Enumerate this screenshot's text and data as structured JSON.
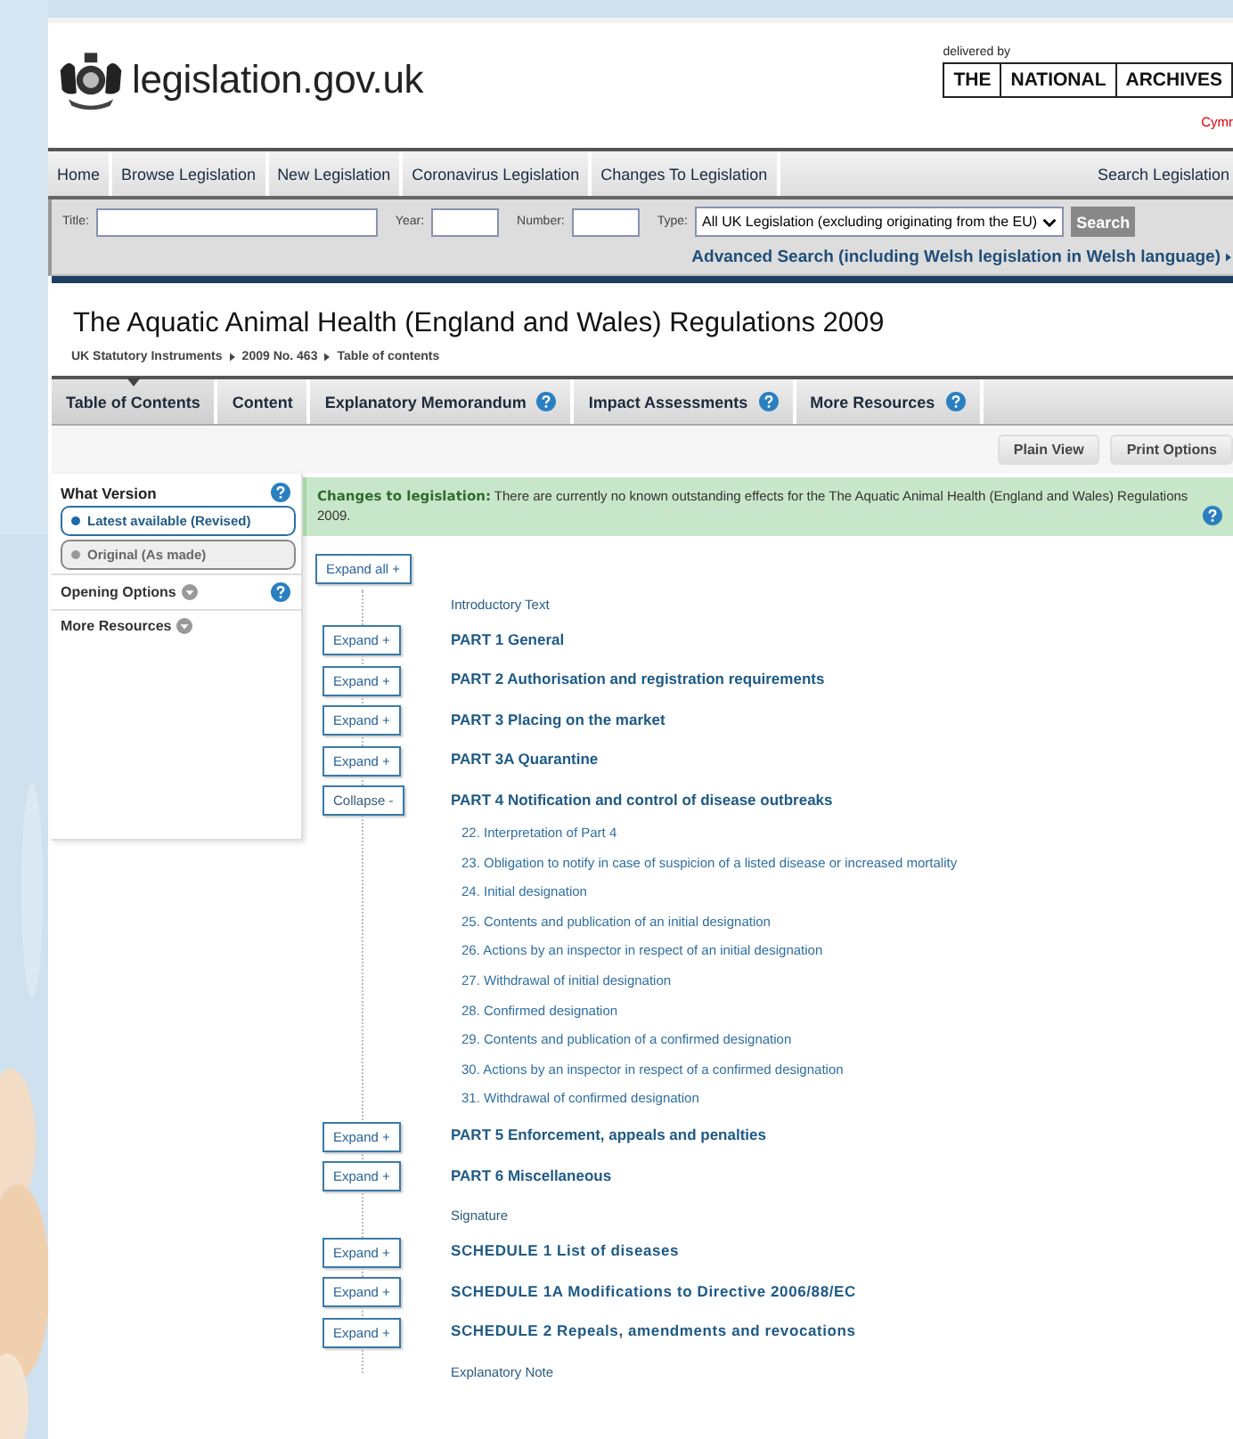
{
  "header": {
    "logo_text": "legislation.gov.uk",
    "delivered_by": "delivered by",
    "archives": [
      "THE",
      "NATIONAL",
      "ARCHIVES"
    ],
    "language_link": "Cymr"
  },
  "nav": {
    "items": [
      {
        "label": "Home"
      },
      {
        "label": "Browse Legislation"
      },
      {
        "label": "New Legislation"
      },
      {
        "label": "Coronavirus Legislation"
      },
      {
        "label": "Changes To Legislation"
      }
    ],
    "search_link": "Search Legislation"
  },
  "search": {
    "title_label": "Title:",
    "year_label": "Year:",
    "number_label": "Number:",
    "type_label": "Type:",
    "type_value": "All UK Legislation (excluding originating from the EU)",
    "button": "Search",
    "advanced_link": "Advanced Search (including Welsh legislation in Welsh language)"
  },
  "document": {
    "title": "The Aquatic Animal Health (England and Wales) Regulations 2009",
    "breadcrumb": [
      "UK Statutory Instruments",
      "2009 No. 463",
      "Table of contents"
    ]
  },
  "tabs": [
    {
      "label": "Table of Contents",
      "selected": true,
      "help": false
    },
    {
      "label": "Content",
      "selected": false,
      "help": false
    },
    {
      "label": "Explanatory Memorandum",
      "selected": false,
      "help": true
    },
    {
      "label": "Impact Assessments",
      "selected": false,
      "help": true
    },
    {
      "label": "More Resources",
      "selected": false,
      "help": true
    }
  ],
  "view_buttons": [
    "Plain View",
    "Print Options"
  ],
  "sidebar": {
    "heading": "What Version",
    "options": [
      {
        "label": "Latest available (Revised)",
        "selected": true
      },
      {
        "label": "Original (As made)",
        "selected": false
      }
    ],
    "sections": [
      {
        "label": "Opening Options",
        "help": true
      },
      {
        "label": "More Resources",
        "help": false
      }
    ]
  },
  "changes": {
    "heading": "Changes to legislation:",
    "text": "There are currently no known outstanding effects for the The Aquatic Animal Health (England and Wales) Regulations 2009."
  },
  "toc": {
    "expand_all": "Expand all +",
    "entries": [
      {
        "kind": "text",
        "title": "Introductory Text"
      },
      {
        "kind": "part",
        "title": "PART 1 General",
        "button": "Expand +",
        "expanded": false
      },
      {
        "kind": "part",
        "title": "PART 2 Authorisation and registration requirements",
        "button": "Expand +",
        "expanded": false
      },
      {
        "kind": "part",
        "title": "PART 3 Placing on the market",
        "button": "Expand +",
        "expanded": false
      },
      {
        "kind": "part",
        "title": "PART 3A Quarantine",
        "button": "Expand +",
        "expanded": false
      },
      {
        "kind": "part",
        "title": "PART 4 Notification and control of disease outbreaks",
        "button": "Collapse -",
        "expanded": true,
        "children": [
          "22. Interpretation of Part 4",
          "23. Obligation to notify in case of suspicion of a listed disease or increased mortality",
          "24. Initial designation",
          "25. Contents and publication of an initial designation",
          "26. Actions by an inspector in respect of an initial designation",
          "27. Withdrawal of initial designation",
          "28. Confirmed designation",
          "29. Contents and publication of a confirmed designation",
          "30. Actions by an inspector in respect of a confirmed designation",
          "31. Withdrawal of confirmed designation"
        ]
      },
      {
        "kind": "part",
        "title": "PART 5 Enforcement, appeals and penalties",
        "button": "Expand +",
        "expanded": false
      },
      {
        "kind": "part",
        "title": "PART 6 Miscellaneous",
        "button": "Expand +",
        "expanded": false
      },
      {
        "kind": "text",
        "title": "Signature"
      },
      {
        "kind": "schedule",
        "title": "SCHEDULE 1 List of diseases",
        "button": "Expand +",
        "expanded": false
      },
      {
        "kind": "schedule",
        "title": "SCHEDULE 1A Modifications to Directive 2006/88/EC",
        "button": "Expand +",
        "expanded": false
      },
      {
        "kind": "schedule",
        "title": "SCHEDULE 2 Repeals, amendments and revocations",
        "button": "Expand +",
        "expanded": false
      },
      {
        "kind": "text",
        "title": "Explanatory Note"
      }
    ]
  }
}
